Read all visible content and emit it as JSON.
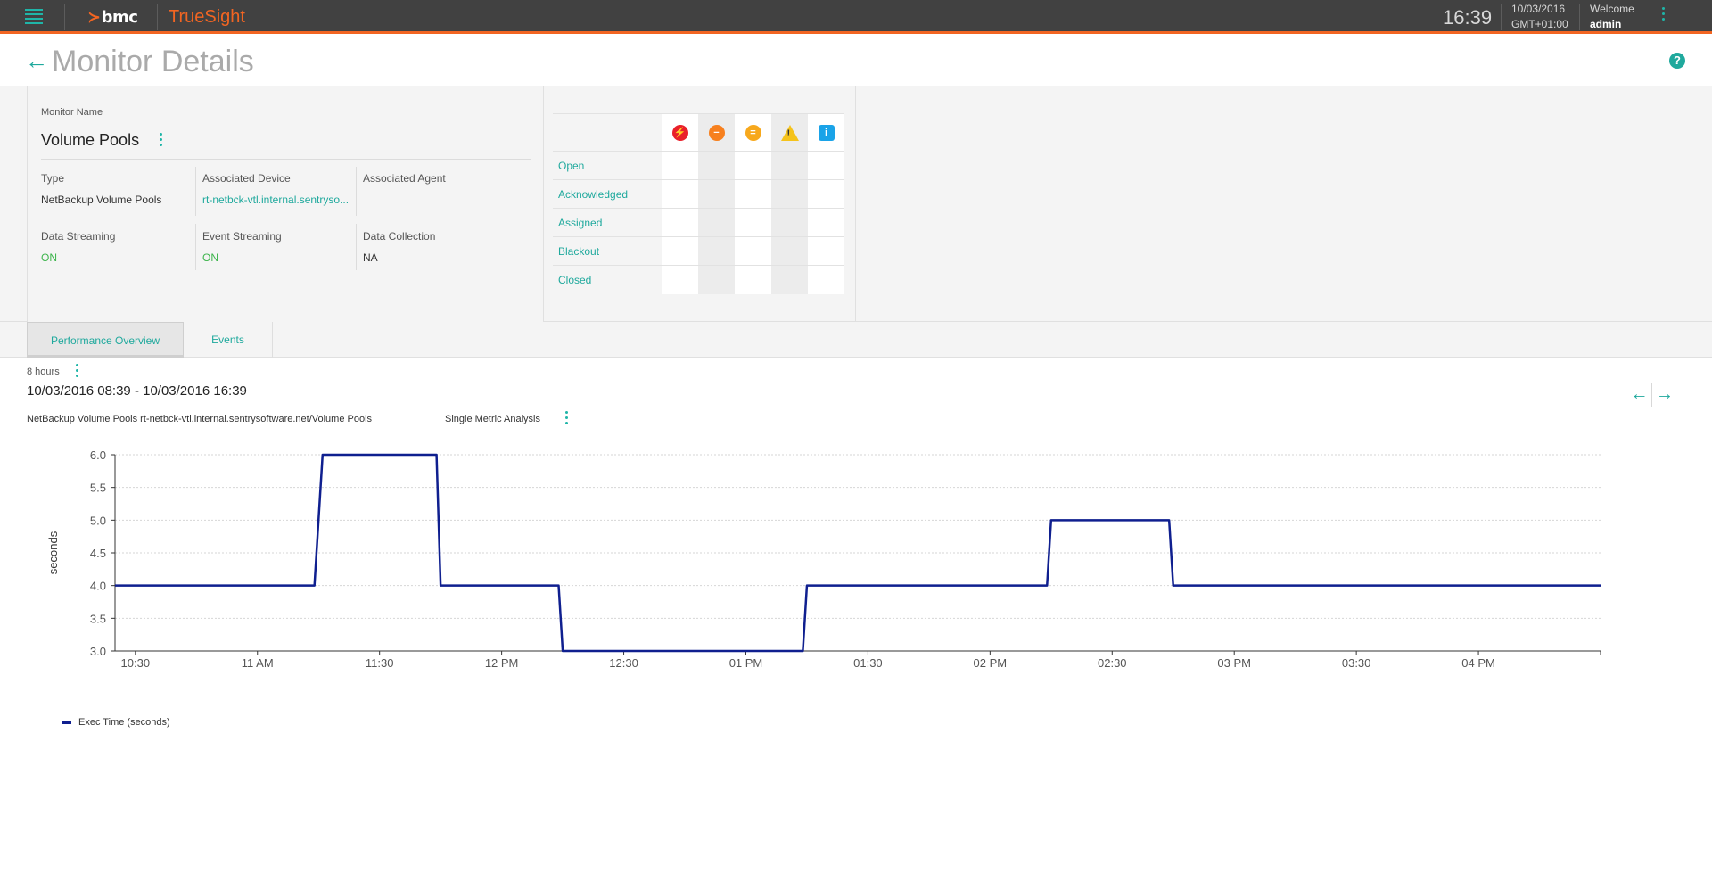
{
  "header": {
    "brand": "bmc",
    "product": "TrueSight",
    "time": "16:39",
    "date": "10/03/2016",
    "timezone": "GMT+01:00",
    "welcome": "Welcome",
    "user": "admin"
  },
  "page": {
    "title": "Monitor Details"
  },
  "monitor": {
    "name_label": "Monitor Name",
    "name": "Volume Pools",
    "type_label": "Type",
    "type": "NetBackup Volume Pools",
    "device_label": "Associated Device",
    "device": "rt-netbck-vtl.internal.sentryso...",
    "agent_label": "Associated Agent",
    "agent": "",
    "data_streaming_label": "Data Streaming",
    "data_streaming": "ON",
    "event_streaming_label": "Event Streaming",
    "event_streaming": "ON",
    "data_collection_label": "Data Collection",
    "data_collection": "NA"
  },
  "event_status": {
    "severity_icons": [
      "critical-icon",
      "major-icon",
      "minor-icon",
      "warning-icon",
      "info-icon"
    ],
    "rows": [
      "Open",
      "Acknowledged",
      "Assigned",
      "Blackout",
      "Closed"
    ]
  },
  "tabs": [
    {
      "label": "Performance Overview",
      "active": true
    },
    {
      "label": "Events",
      "active": false
    }
  ],
  "chart_header": {
    "range": "8 hours",
    "date_range": "10/03/2016 08:39 - 10/03/2016 16:39",
    "metric_name": "NetBackup Volume Pools rt-netbck-vtl.internal.sentrysoftware.net/Volume Pools",
    "analysis": "Single Metric Analysis"
  },
  "colors": {
    "accent": "#1fa99d",
    "brand_orange": "#f26522",
    "series": "#0f1f8f"
  },
  "chart_data": {
    "type": "line",
    "title": "",
    "xlabel": "",
    "ylabel": "seconds",
    "ylim": [
      3.0,
      6.0
    ],
    "yticks": [
      "6.0",
      "5.5",
      "5.0",
      "4.5",
      "4.0",
      "3.5",
      "3.0"
    ],
    "xlim": [
      "10:25",
      "16:30"
    ],
    "xticks": [
      "10:30",
      "11 AM",
      "11:30",
      "12 PM",
      "12:30",
      "01 PM",
      "01:30",
      "02 PM",
      "02:30",
      "03 PM",
      "03:30",
      "04 PM"
    ],
    "grid": true,
    "legend": "bottom-left",
    "series": [
      {
        "name": "Exec Time (seconds)",
        "x": [
          "10:25",
          "11:14",
          "11:16",
          "11:44",
          "11:45",
          "12:14",
          "12:15",
          "13:14",
          "13:15",
          "14:14",
          "14:15",
          "14:44",
          "14:45",
          "16:30"
        ],
        "values": [
          4.0,
          4.0,
          6.0,
          6.0,
          4.0,
          4.0,
          3.0,
          3.0,
          4.0,
          4.0,
          5.0,
          5.0,
          4.0,
          4.0
        ]
      }
    ]
  }
}
